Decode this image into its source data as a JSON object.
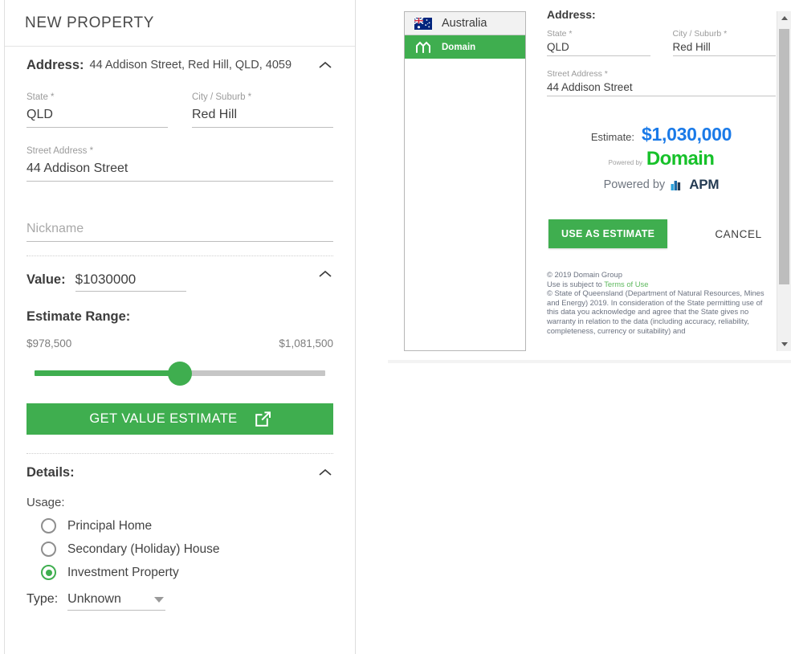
{
  "left_panel": {
    "title": "NEW PROPERTY",
    "address_section": {
      "heading": "Address:",
      "summary": "44 Addison Street, Red Hill, QLD, 4059",
      "collapse_icon": "chevron-up-icon",
      "state": {
        "label": "State *",
        "value": "QLD"
      },
      "city": {
        "label": "City / Suburb *",
        "value": "Red Hill"
      },
      "street": {
        "label": "Street Address *",
        "value": "44 Addison Street"
      },
      "nickname": {
        "label": "",
        "placeholder": "Nickname",
        "value": ""
      }
    },
    "value_section": {
      "heading": "Value:",
      "amount": "$1030000",
      "collapse_icon": "chevron-up-icon",
      "estimate_range_title": "Estimate Range:",
      "range_min_label": "$978,500",
      "range_max_label": "$1,081,500",
      "slider_percent": 50,
      "get_estimate_button": "GET VALUE ESTIMATE",
      "get_estimate_icon": "external-link-icon"
    },
    "details_section": {
      "heading": "Details:",
      "collapse_icon": "chevron-up-icon",
      "usage_label": "Usage:",
      "usage_options": [
        {
          "label": "Principal Home",
          "checked": false
        },
        {
          "label": "Secondary (Holiday) House",
          "checked": false
        },
        {
          "label": "Investment Property",
          "checked": true
        }
      ],
      "type_label": "Type:",
      "type_value": "Unknown",
      "type_caret_icon": "caret-down-icon"
    }
  },
  "dialog": {
    "tabs": [
      {
        "label": "Australia",
        "icon": "australia-flag-icon",
        "selected": false
      },
      {
        "label": "Domain",
        "icon": "domain-logo-icon",
        "selected": true
      }
    ],
    "address_heading": "Address:",
    "state": {
      "label": "State *",
      "value": "QLD"
    },
    "city": {
      "label": "City / Suburb *",
      "value": "Red Hill"
    },
    "street": {
      "label": "Street Address *",
      "value": "44 Addison Street"
    },
    "estimate_label": "Estimate:",
    "estimate_amount": "$1,030,000",
    "powered_by_small": "Powered by",
    "domain_word": "Domain",
    "apm_powered_by": "Powered by",
    "apm_word": "APM",
    "apm_icon": "apm-bars-icon",
    "use_button": "USE AS ESTIMATE",
    "cancel_button": "CANCEL",
    "legal": {
      "line1": "© 2019 Domain Group",
      "line2_prefix": "Use is subject to ",
      "line2_link": "Terms of Use",
      "line3": "© State of Queensland (Department of Natural Resources, Mines and Energy) 2019. In consideration of the State permitting use of this data you acknowledge and agree that the State gives no warranty in relation to the data (including accuracy, reliability, completeness, currency or suitability) and"
    },
    "scrollbar": {
      "up_icon": "scroll-up-arrow-icon",
      "down_icon": "scroll-down-arrow-icon"
    }
  },
  "colors": {
    "green": "#3fae4f",
    "domain_green": "#17c12a",
    "estimate_blue": "#1a7ae8",
    "link_green": "#5cb85c"
  }
}
